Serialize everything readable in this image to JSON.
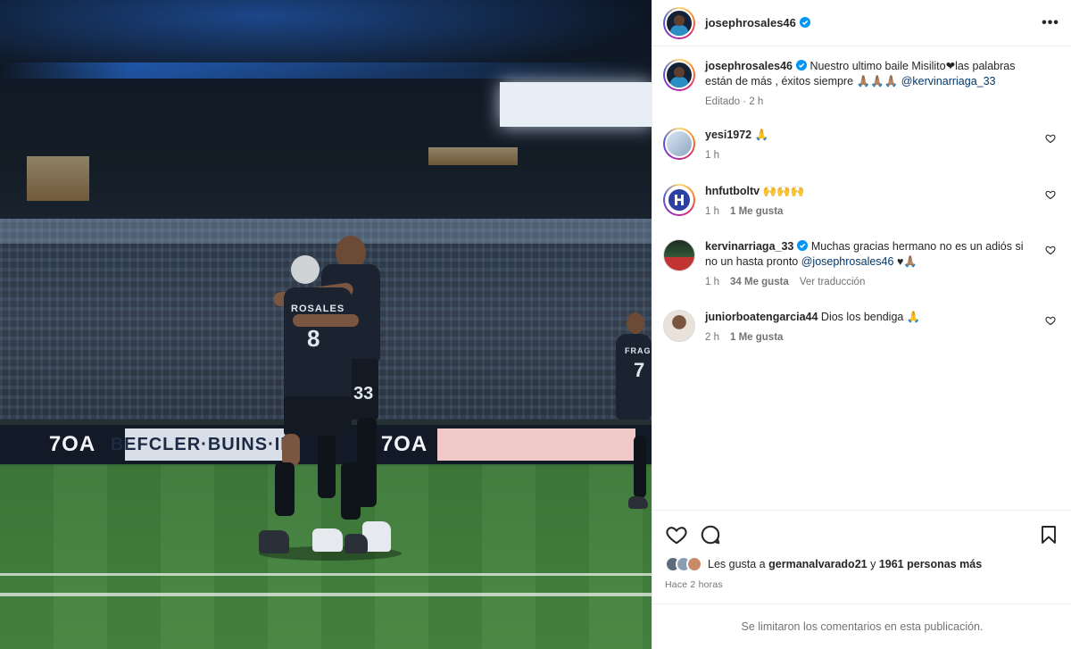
{
  "post": {
    "author": {
      "username": "josephrosales46",
      "verified": true
    },
    "more_icon": "more-horizontal-icon"
  },
  "photo": {
    "adboard": [
      "7OA",
      "BEFCLER·BUINS·INI",
      "7OA",
      ""
    ],
    "players": {
      "front_name": "ROSALES",
      "front_number": "8",
      "back_number": "33",
      "right_number": "7",
      "right_name": "FRAGA"
    }
  },
  "caption": {
    "username": "josephrosales46",
    "text": "Nuestro ultimo baile Misilito❤las palabras están de más , éxitos siempre 🙏🏽🙏🏽🙏🏽",
    "mention": "@kervinarriaga_33",
    "meta": "Editado · 2 h"
  },
  "comments": [
    {
      "username": "yesi1972",
      "text": "🙏",
      "time": "1 h",
      "likes": "",
      "translate": ""
    },
    {
      "username": "hnfutboltv",
      "text": "🙌🙌🙌",
      "time": "1 h",
      "likes": "1 Me gusta",
      "translate": ""
    },
    {
      "username": "kervinarriaga_33",
      "verified": true,
      "text": "Muchas gracias hermano no es un adiós si no un hasta pronto",
      "mention": "@josephrosales46",
      "trailing": "♥🙏🏽",
      "time": "1 h",
      "likes": "34 Me gusta",
      "translate": "Ver traducción"
    },
    {
      "username": "juniorboatengarcia44",
      "text": "Dios los bendiga 🙏",
      "time": "2 h",
      "likes": "1 Me gusta",
      "translate": ""
    }
  ],
  "actions": {
    "like_icon": "heart-icon",
    "comment_icon": "comment-icon",
    "save_icon": "bookmark-icon"
  },
  "likes": {
    "prefix": "Les gusta a",
    "first_user": "germanalvarado21",
    "connector": "y",
    "others": "1961 personas más"
  },
  "posted_ago": "Hace 2 horas",
  "comments_limited": "Se limitaron los comentarios en esta publicación.",
  "colors": {
    "link": "#00376b",
    "verified": "#0095f6",
    "muted": "#737373"
  }
}
